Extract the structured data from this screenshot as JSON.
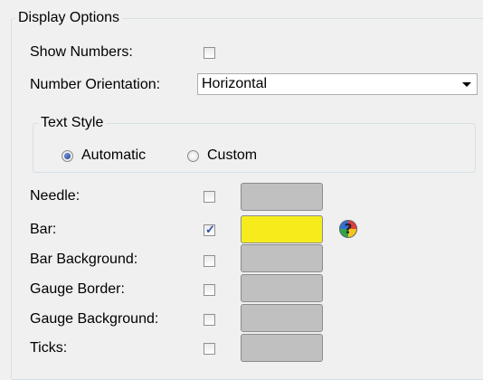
{
  "display_options": {
    "title": "Display Options",
    "show_numbers": {
      "label": "Show Numbers:",
      "checked": false
    },
    "number_orientation": {
      "label": "Number Orientation:",
      "value": "Horizontal"
    },
    "text_style": {
      "title": "Text Style",
      "options": [
        {
          "label": "Automatic",
          "selected": true
        },
        {
          "label": "Custom",
          "selected": false
        }
      ]
    },
    "rows": [
      {
        "label": "Needle:",
        "checked": false,
        "color": "#c0c0c0"
      },
      {
        "label": "Bar:",
        "checked": true,
        "color": "#f6ec1c"
      },
      {
        "label": "Bar Background:",
        "checked": false,
        "color": "#c0c0c0"
      },
      {
        "label": "Gauge Border:",
        "checked": false,
        "color": "#c0c0c0"
      },
      {
        "label": "Gauge Background:",
        "checked": false,
        "color": "#c0c0c0"
      },
      {
        "label": "Ticks:",
        "checked": false,
        "color": "#c0c0c0"
      }
    ],
    "help_icon": {
      "symbol": "?",
      "icon": "help-icon"
    }
  }
}
